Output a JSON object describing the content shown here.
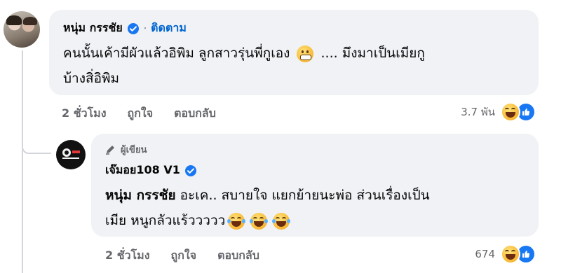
{
  "comment": {
    "author": "หนุ่ม กรรชัย",
    "follow": "ติดตาม",
    "text_line1": "คนนั้นเค้ามีผัวแล้วอิพิม ลูกสาวรุ่นพี่กูเอง",
    "text_line1_tail": " .... มึงมาเป็นเมียกู",
    "text_line2": "บ้างสิ่อิพิม",
    "time": "2 ชั่วโมง",
    "like": "ถูกใจ",
    "reply": "ตอบกลับ",
    "reaction_count": "3.7 พัน"
  },
  "reply_comment": {
    "badge": "ผู้เขียน",
    "author": "เจ๊มอย108 V1",
    "mention": "หนุ่ม กรรชัย",
    "text_line1": " อะเค.. สบายใจ แยกย้ายนะพ่อ ส่วนเรื่องเป็น",
    "text_line2": "เมีย หนูกลัวแร้ววววว",
    "time": "2 ชั่วโมง",
    "like": "ถูกใจ",
    "reply": "ตอบกลับ",
    "reaction_count": "674"
  },
  "icons": {
    "verified": "verified-badge-icon",
    "grimace": "grimacing-face-emoji",
    "laugh": "laughing-crying-emoji",
    "haha": "haha-reaction-icon",
    "like": "like-reaction-icon",
    "pen": "pen-icon"
  },
  "colors": {
    "bubble": "#f0f2f5",
    "link": "#0064d1",
    "meta": "#65676b",
    "like_blue": "#1877f2"
  }
}
